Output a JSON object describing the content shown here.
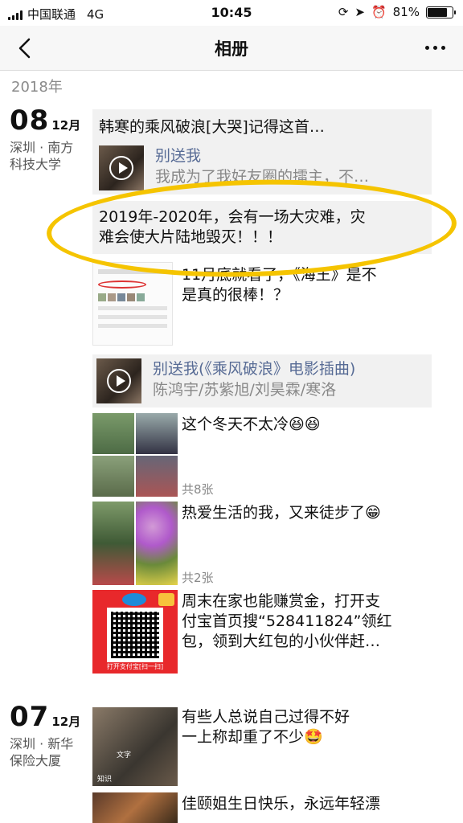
{
  "status": {
    "carrier": "中国联通",
    "network": "4G",
    "time": "10:45",
    "battery_pct": "81%",
    "battery_fraction": 0.81
  },
  "nav": {
    "title": "相册",
    "back_icon": "chevron-left-icon",
    "more_icon": "more-dots-icon"
  },
  "year": "2018年",
  "groups": [
    {
      "day": "08",
      "month": "12月",
      "location_line1": "深圳 · 南方",
      "location_line2": "科技大学"
    },
    {
      "day": "07",
      "month": "12月",
      "location_line1": "深圳 · 新华",
      "location_line2": "保险大厦"
    }
  ],
  "posts": {
    "p1": "韩寒的乘风破浪[大哭]记得这首…",
    "p1_music_title": "别送我",
    "p1_music_sub": "我成为了我好友圈的擂主，不…",
    "p2_line1": "2019年-2020年，会有一场大灾难，灾",
    "p2_line2": "难会使大片陆地毁灭！！！",
    "p3_line1": "11月底就看了，《海王》是不",
    "p3_line2": "是真的很棒！？",
    "p4_title": "别送我(《乘风破浪》电影插曲)",
    "p4_sub": "陈鸿宇/苏紫旭/刘昊霖/寒洛",
    "p5": "这个冬天不太冷😆😆",
    "p5_count": "共8张",
    "p6": "热爱生活的我，又来徒步了😁",
    "p6_count": "共2张",
    "p7_line1": "周末在家也能赚赏金，打开支",
    "p7_line2": "付宝首页搜“528411824”领红",
    "p7_line3": "包，领到大红包的小伙伴赶…",
    "p7_thumb_caption": "打开支付宝[扫一扫]",
    "p8_line1": "有些人总说自己过得不好",
    "p8_line2": "一上称却重了不少🤩",
    "p8_thumb_label1": "文字",
    "p8_thumb_label2": "知识",
    "p9_line1": "佳颐姐生日快乐，永远年轻漂"
  },
  "colors": {
    "link": "#576b95",
    "highlight": "#f5c400",
    "red_packet": "#e8282b"
  }
}
